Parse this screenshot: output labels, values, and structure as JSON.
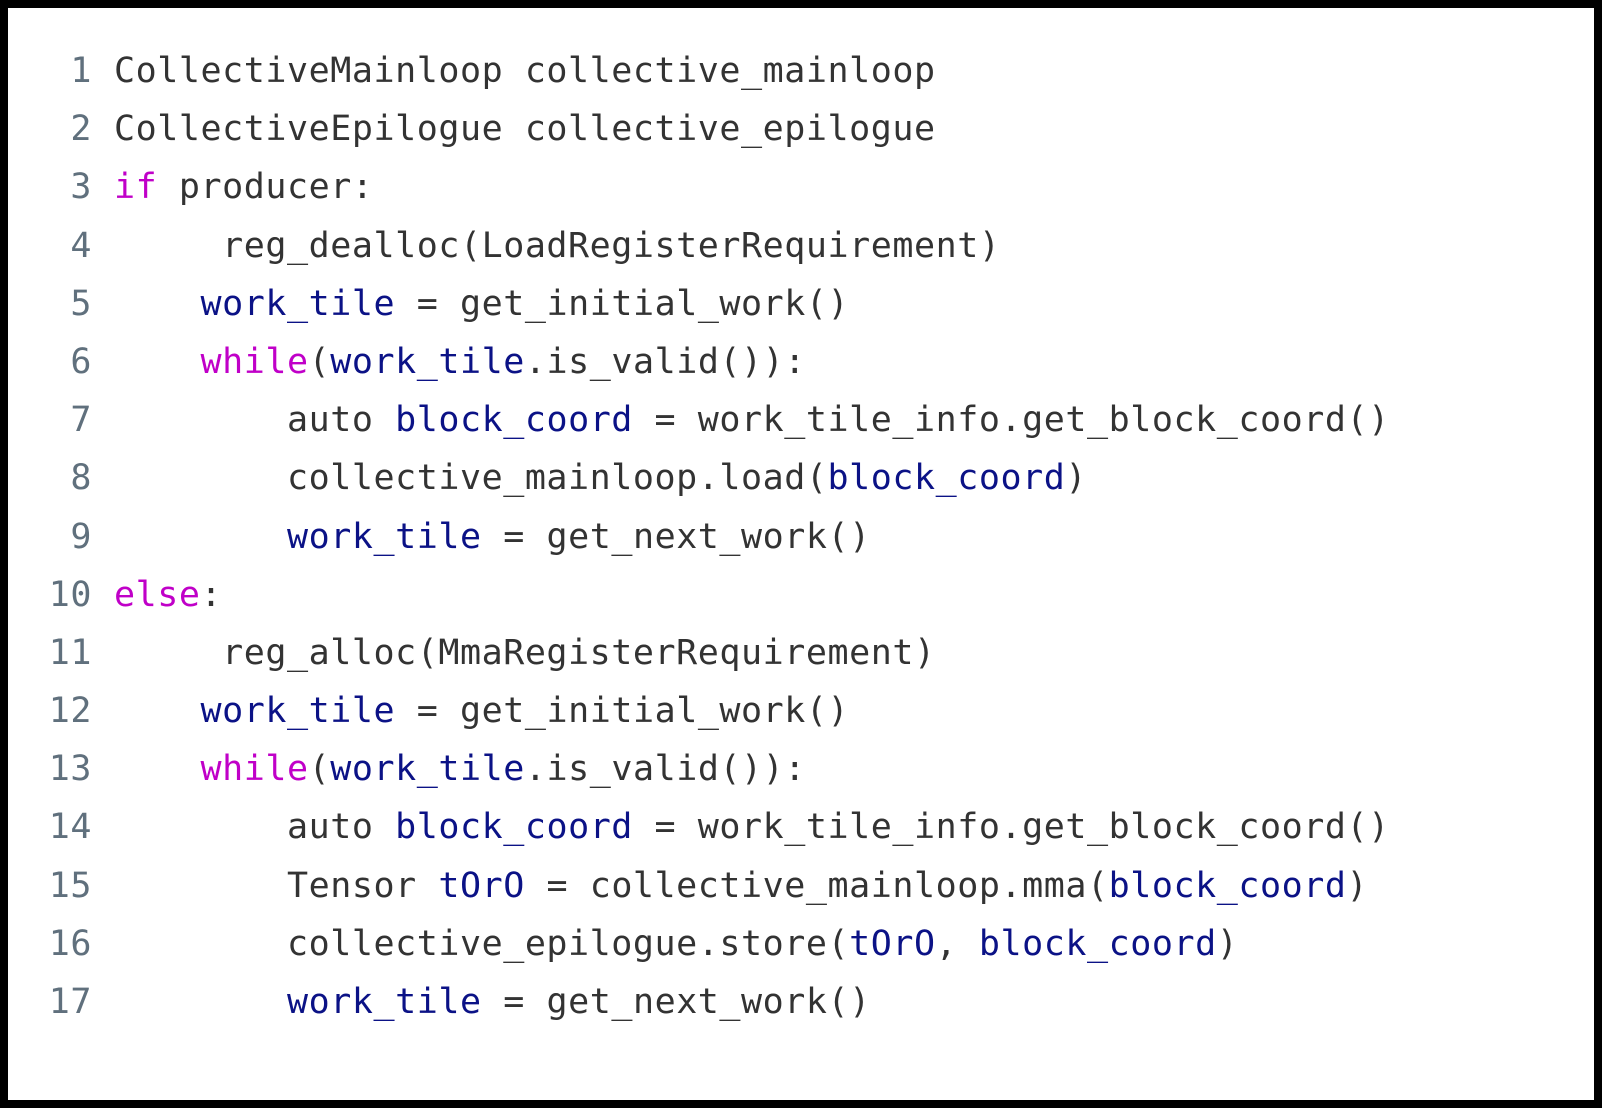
{
  "code_listing": {
    "language": "pseudocode",
    "colors": {
      "background": "#ffffff",
      "border": "#000000",
      "line_number": "#60707d",
      "plain_text": "#333333",
      "keyword": "#c000c8",
      "variable": "#0b1286"
    },
    "lines": [
      {
        "number": "1",
        "tokens": [
          {
            "t": "CollectiveMainloop collective_mainloop",
            "c": "plain"
          }
        ]
      },
      {
        "number": "2",
        "tokens": [
          {
            "t": "CollectiveEpilogue collective_epilogue",
            "c": "plain"
          }
        ]
      },
      {
        "number": "3",
        "tokens": [
          {
            "t": "if",
            "c": "kw"
          },
          {
            "t": " producer:",
            "c": "plain"
          }
        ]
      },
      {
        "number": "4",
        "tokens": [
          {
            "t": "     reg_dealloc(LoadRegisterRequirement)",
            "c": "plain"
          }
        ]
      },
      {
        "number": "5",
        "tokens": [
          {
            "t": "    ",
            "c": "plain"
          },
          {
            "t": "work_tile",
            "c": "var"
          },
          {
            "t": " = get_initial_work()",
            "c": "plain"
          }
        ]
      },
      {
        "number": "6",
        "tokens": [
          {
            "t": "    ",
            "c": "plain"
          },
          {
            "t": "while",
            "c": "kw"
          },
          {
            "t": "(",
            "c": "plain"
          },
          {
            "t": "work_tile",
            "c": "var"
          },
          {
            "t": ".is_valid()):",
            "c": "plain"
          }
        ]
      },
      {
        "number": "7",
        "tokens": [
          {
            "t": "        auto ",
            "c": "plain"
          },
          {
            "t": "block_coord",
            "c": "var"
          },
          {
            "t": " = work_tile_info.get_block_coord()",
            "c": "plain"
          }
        ]
      },
      {
        "number": "8",
        "tokens": [
          {
            "t": "        collective_mainloop.load(",
            "c": "plain"
          },
          {
            "t": "block_coord",
            "c": "var"
          },
          {
            "t": ")",
            "c": "plain"
          }
        ]
      },
      {
        "number": "9",
        "tokens": [
          {
            "t": "        ",
            "c": "plain"
          },
          {
            "t": "work_tile",
            "c": "var"
          },
          {
            "t": " = get_next_work()",
            "c": "plain"
          }
        ]
      },
      {
        "number": "10",
        "tokens": [
          {
            "t": "else",
            "c": "kw"
          },
          {
            "t": ":",
            "c": "plain"
          }
        ]
      },
      {
        "number": "11",
        "tokens": [
          {
            "t": "     reg_alloc(MmaRegisterRequirement)",
            "c": "plain"
          }
        ]
      },
      {
        "number": "12",
        "tokens": [
          {
            "t": "    ",
            "c": "plain"
          },
          {
            "t": "work_tile",
            "c": "var"
          },
          {
            "t": " = get_initial_work()",
            "c": "plain"
          }
        ]
      },
      {
        "number": "13",
        "tokens": [
          {
            "t": "    ",
            "c": "plain"
          },
          {
            "t": "while",
            "c": "kw"
          },
          {
            "t": "(",
            "c": "plain"
          },
          {
            "t": "work_tile",
            "c": "var"
          },
          {
            "t": ".is_valid()):",
            "c": "plain"
          }
        ]
      },
      {
        "number": "14",
        "tokens": [
          {
            "t": "        auto ",
            "c": "plain"
          },
          {
            "t": "block_coord",
            "c": "var"
          },
          {
            "t": " = work_tile_info.get_block_coord()",
            "c": "plain"
          }
        ]
      },
      {
        "number": "15",
        "tokens": [
          {
            "t": "        Tensor ",
            "c": "plain"
          },
          {
            "t": "tOrO",
            "c": "var"
          },
          {
            "t": " = collective_mainloop.mma(",
            "c": "plain"
          },
          {
            "t": "block_coord",
            "c": "var"
          },
          {
            "t": ")",
            "c": "plain"
          }
        ]
      },
      {
        "number": "16",
        "tokens": [
          {
            "t": "        collective_epilogue.store(",
            "c": "plain"
          },
          {
            "t": "tOrO",
            "c": "var"
          },
          {
            "t": ", ",
            "c": "plain"
          },
          {
            "t": "block_coord",
            "c": "var"
          },
          {
            "t": ")",
            "c": "plain"
          }
        ]
      },
      {
        "number": "17",
        "tokens": [
          {
            "t": "        ",
            "c": "plain"
          },
          {
            "t": "work_tile",
            "c": "var"
          },
          {
            "t": " = get_next_work()",
            "c": "plain"
          }
        ]
      }
    ]
  }
}
